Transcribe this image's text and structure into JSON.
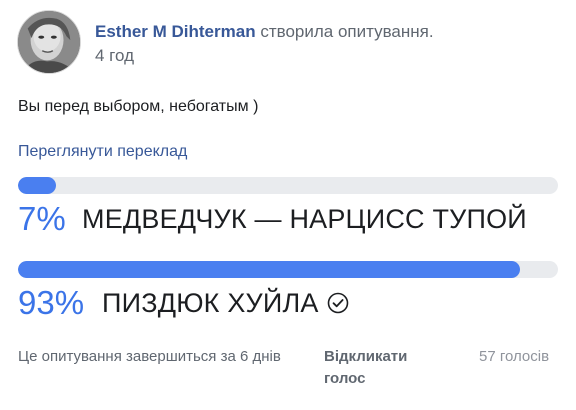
{
  "header": {
    "author": "Esther M Dihterman",
    "action": "створила опитування.",
    "time": "4 год"
  },
  "post": {
    "text": "Вы перед выбором, небогатым )",
    "translate_link": "Переглянути переклад"
  },
  "poll": {
    "options": [
      {
        "percent_label": "7%",
        "label": "МЕДВЕДЧУК — НАРЦИСС ТУПОЙ",
        "fraction": 0.07,
        "selected": false
      },
      {
        "percent_label": "93%",
        "label": "ПИЗДЮК ХУЙЛА",
        "fraction": 0.93,
        "selected": true
      }
    ],
    "ends_text": "Це опитування завершиться за 6 днів",
    "revoke_label": "Відкликати голос",
    "votes_label": "57 голосів"
  },
  "colors": {
    "accent": "#4a7ff0",
    "track": "#e9ebee",
    "link": "#385898",
    "muted": "#606770"
  },
  "icons": {
    "selected_option": "check-circle-icon",
    "avatar": "profile-avatar"
  }
}
